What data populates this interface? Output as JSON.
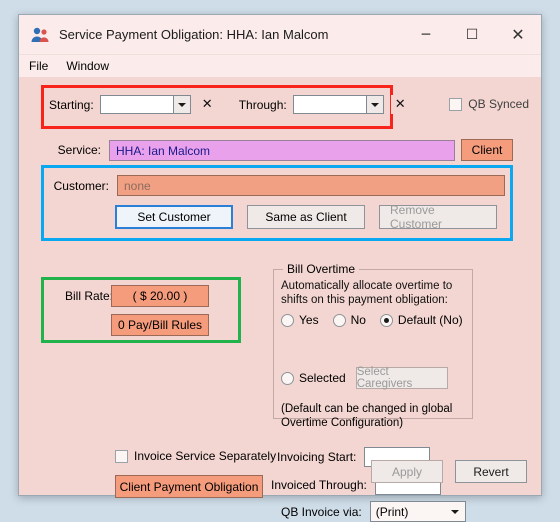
{
  "window": {
    "title": "Service Payment Obligation: HHA: Ian Malcom",
    "icon": "people-icon",
    "caption": {
      "minimize": "─",
      "maximize": "☐",
      "close": "✕"
    }
  },
  "menubar": {
    "items": [
      {
        "label": "File"
      },
      {
        "label": "Window"
      }
    ]
  },
  "dates": {
    "starting_label": "Starting:",
    "starting_value": "",
    "through_label": "Through:",
    "through_value": "",
    "clear_icon": "✕"
  },
  "qb_synced": {
    "label": "QB Synced",
    "checked": false
  },
  "service": {
    "label": "Service:",
    "value": "HHA: Ian Malcom",
    "client_button": "Client"
  },
  "customer": {
    "label": "Customer:",
    "value": "none",
    "set_button": "Set Customer",
    "same_as_client_button": "Same as Client",
    "remove_button": "Remove Customer"
  },
  "bill_rate": {
    "label": "Bill Rate:",
    "value": "( $ 20.00 )",
    "rules_button": "0 Pay/Bill Rules"
  },
  "bill_overtime": {
    "title": "Bill Overtime",
    "description": "Automatically allocate overtime to shifts on this payment obligation:",
    "options": [
      {
        "label": "Yes",
        "checked": false
      },
      {
        "label": "No",
        "checked": false
      },
      {
        "label": "Default (No)",
        "checked": true
      },
      {
        "label": "Selected",
        "checked": false
      }
    ],
    "select_caregivers_button": "Select Caregivers",
    "note": "(Default can be changed in global Overtime Configuration)"
  },
  "bottom": {
    "invoice_separately_label": "Invoice Service Separately",
    "invoice_separately_checked": false,
    "client_payment_obligation_button": "Client Payment Obligation",
    "invoicing_start_label": "Invoicing Start:",
    "invoicing_start_value": "",
    "invoiced_through_label": "Invoiced Through:",
    "invoiced_through_value": "",
    "qb_invoice_via_label": "QB Invoice via:",
    "qb_invoice_via_value": "(Print)",
    "apply_button": "Apply",
    "revert_button": "Revert"
  },
  "highlights": {
    "red": "#f8241b",
    "cyan": "#0aa8f0",
    "green": "#22b24c"
  }
}
